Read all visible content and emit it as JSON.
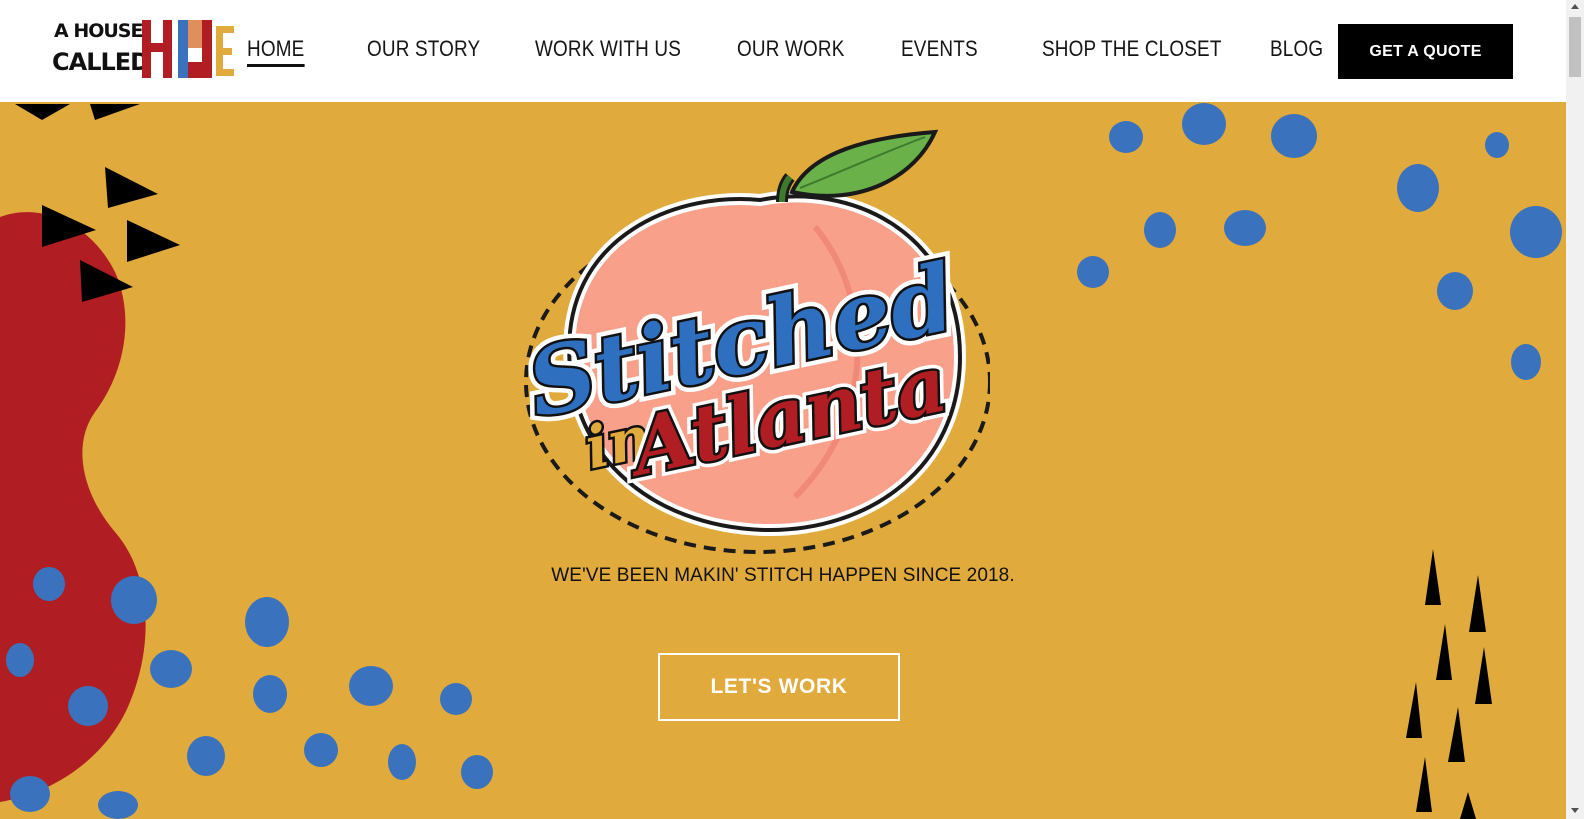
{
  "brand": {
    "logo_line1": "A HOUSE",
    "logo_line2": "CALLED",
    "logo_hue": "HUE"
  },
  "nav": {
    "items": [
      {
        "label": "HOME",
        "active": true
      },
      {
        "label": "OUR STORY",
        "active": false
      },
      {
        "label": "WORK WITH US",
        "active": false
      },
      {
        "label": "OUR WORK",
        "active": false
      },
      {
        "label": "EVENTS",
        "active": false
      },
      {
        "label": "SHOP THE CLOSET",
        "active": false
      },
      {
        "label": "BLOG",
        "active": false
      }
    ],
    "quote_label": "GET A QUOTE"
  },
  "hero": {
    "badge_word1": "Stitched",
    "badge_word2": "in",
    "badge_word3": "Atlanta",
    "tagline": "WE'VE BEEN MAKIN' STITCH HAPPEN SINCE 2018.",
    "cta_label": "LET'S WORK"
  },
  "colors": {
    "hero_background": "#E1AA3C",
    "accent_red": "#B01E23",
    "accent_blue": "#3A72BD",
    "peach": "#F8A08A",
    "leaf_green": "#6BB14A"
  }
}
